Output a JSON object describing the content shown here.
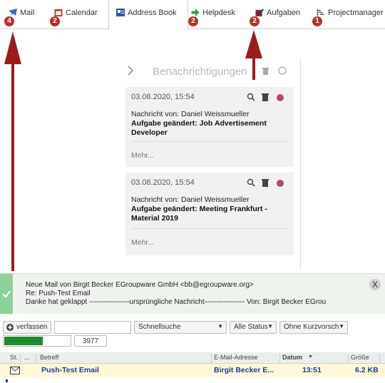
{
  "tabs": [
    {
      "label": "Mail",
      "badge": "4",
      "icon": "mail-icon"
    },
    {
      "label": "Calendar",
      "badge": "2",
      "icon": "calendar-icon"
    },
    {
      "label": "Address Book",
      "badge": "",
      "icon": "address-book-icon"
    },
    {
      "label": "Helpdesk",
      "badge": "2",
      "icon": "helpdesk-icon"
    },
    {
      "label": "Aufgaben",
      "badge": "2",
      "icon": "tasks-icon"
    },
    {
      "label": "Projectmanager",
      "badge": "1",
      "icon": "projectmanager-icon"
    }
  ],
  "notifications": {
    "title": "Benachrichtigungen",
    "cards": [
      {
        "date": "03.08.2020, 15:54",
        "from": "Nachricht von: Daniel Weissmueller",
        "subject": "Aufgabe geändert: Job Advertisement Developer",
        "more": "Mehr..."
      },
      {
        "date": "03.08.2020, 15:54",
        "from": "Nachricht von: Daniel Weissmueller",
        "subject": "Aufgabe geändert: Meeting Frankfurt - Material 2019",
        "more": "Mehr..."
      }
    ]
  },
  "newmail": {
    "line1": "Neue Mail von Birgit Becker EGroupware GmbH <bb@egroupware.org>",
    "line2": "Re: Push-Test Email",
    "line3": "Danke hat geklappt -----------------ursprüngliche Nachricht----------------- Von: Birgit Becker EGrou",
    "close": "X"
  },
  "toolbar": {
    "compose": "verfassen",
    "quicksearch": "Schnellsuche",
    "status": "Alle Status",
    "preview": "Ohne Kurzvorscha",
    "count": "3977"
  },
  "grid": {
    "headers": {
      "st": "St.",
      "dots": "...",
      "subject": "Betreff",
      "email": "E-Mail-Adresse",
      "date": "Datum",
      "size": "Größe"
    },
    "row": {
      "subject": "Push-Test Email",
      "email": "Birgit Becker E...",
      "time": "13:51",
      "size": "6.2 KB"
    }
  },
  "colors": {
    "badge": "#b5302b",
    "arrow": "#9b1c1c",
    "dot": "#b04a6e",
    "success": "#8ed19a",
    "progress": "#1e8a2e",
    "link": "#1b3c9a"
  }
}
